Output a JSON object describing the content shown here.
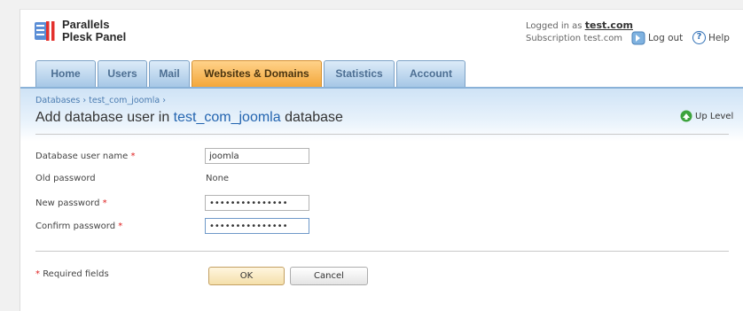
{
  "header": {
    "brand_line1": "Parallels",
    "brand_line2": "Plesk Panel",
    "logged_in_prefix": "Logged in as",
    "logged_in_user": "test.com",
    "subscription": "Subscription test.com",
    "logout_label": "Log out",
    "help_label": "Help"
  },
  "tabs": [
    {
      "label": "Home",
      "active": false
    },
    {
      "label": "Users",
      "active": false
    },
    {
      "label": "Mail",
      "active": false
    },
    {
      "label": "Websites & Domains",
      "active": true
    },
    {
      "label": "Statistics",
      "active": false
    },
    {
      "label": "Account",
      "active": false
    }
  ],
  "breadcrumb": {
    "item1": "Databases",
    "item2": "test_com_joomla",
    "separator": "›"
  },
  "page": {
    "title_prefix": "Add database user in",
    "title_db": "test_com_joomla",
    "title_suffix": "database",
    "up_level_label": "Up Level"
  },
  "form": {
    "db_user_label": "Database user name",
    "db_user_value": "joomla",
    "old_password_label": "Old password",
    "old_password_value": "None",
    "new_password_label": "New password",
    "new_password_value": "passwordpasswor",
    "confirm_password_label": "Confirm password",
    "confirm_password_value": "passwordpasswor",
    "required_mark": "*",
    "required_fields_label": "Required fields",
    "ok_label": "OK",
    "cancel_label": "Cancel"
  },
  "colors": {
    "active_tab": "#f3a73a",
    "tab": "#a6c7e6",
    "link": "#2465b0",
    "required": "#e02020"
  }
}
